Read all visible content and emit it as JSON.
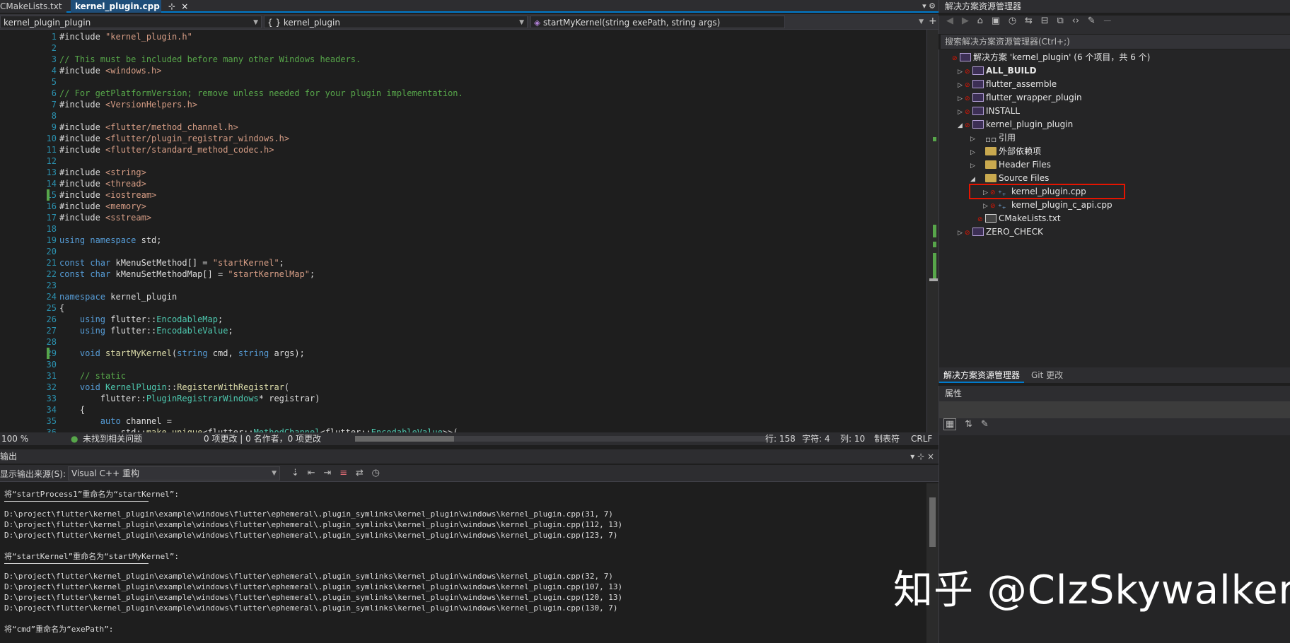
{
  "tabs": [
    {
      "label": "CMakeLists.txt",
      "active": false
    },
    {
      "label": "kernel_plugin.cpp",
      "active": true,
      "pin": "⊹",
      "close": "×"
    }
  ],
  "tabbar_icons": "▾ ⚙",
  "nav": {
    "project": "kernel_plugin_plugin",
    "scope": "{ } kernel_plugin",
    "member": "startMyKernel(string exePath, string args)"
  },
  "code_lines": [
    {
      "n": "1",
      "html": "<span class='plain'>#include </span><span class='inc'>\"kernel_plugin.h\"</span>"
    },
    {
      "n": "2",
      "html": ""
    },
    {
      "n": "3",
      "html": "<span class='cm'>// This must be included before many other Windows headers.</span>"
    },
    {
      "n": "4",
      "html": "<span class='plain'>#include </span><span class='inc'>&lt;windows.h&gt;</span>"
    },
    {
      "n": "5",
      "html": ""
    },
    {
      "n": "6",
      "html": "<span class='cm'>// For getPlatformVersion; remove unless needed for your plugin implementation.</span>"
    },
    {
      "n": "7",
      "html": "<span class='plain'>#include </span><span class='inc'>&lt;VersionHelpers.h&gt;</span>"
    },
    {
      "n": "8",
      "html": ""
    },
    {
      "n": "9",
      "html": "<span class='plain'>#include </span><span class='inc'>&lt;flutter/method_channel.h&gt;</span>"
    },
    {
      "n": "10",
      "html": "<span class='plain'>#include </span><span class='inc'>&lt;flutter/plugin_registrar_windows.h&gt;</span>"
    },
    {
      "n": "11",
      "html": "<span class='plain'>#include </span><span class='inc'>&lt;flutter/standard_method_codec.h&gt;</span>"
    },
    {
      "n": "12",
      "html": ""
    },
    {
      "n": "13",
      "html": "<span class='plain'>#include </span><span class='inc'>&lt;string&gt;</span>"
    },
    {
      "n": "14",
      "html": "<span class='plain'>#include </span><span class='inc'>&lt;thread&gt;</span>"
    },
    {
      "n": "15",
      "html": "<span class='plain'>#include </span><span class='inc'>&lt;iostream&gt;</span>",
      "changed": true
    },
    {
      "n": "16",
      "html": "<span class='plain'>#include </span><span class='inc'>&lt;memory&gt;</span>"
    },
    {
      "n": "17",
      "html": "<span class='plain'>#include </span><span class='inc'>&lt;sstream&gt;</span>"
    },
    {
      "n": "18",
      "html": ""
    },
    {
      "n": "19",
      "html": "<span class='kw'>using namespace</span><span class='plain'> std;</span>"
    },
    {
      "n": "20",
      "html": ""
    },
    {
      "n": "21",
      "html": "<span class='kw'>const char</span><span class='plain'> kMenuSetMethod[] = </span><span class='str'>\"startKernel\"</span><span class='plain'>;</span>"
    },
    {
      "n": "22",
      "html": "<span class='kw'>const char</span><span class='plain'> kMenuSetMethodMap[] = </span><span class='str'>\"startKernelMap\"</span><span class='plain'>;</span>"
    },
    {
      "n": "23",
      "html": ""
    },
    {
      "n": "24",
      "html": "<span class='kw'>namespace</span><span class='plain'> kernel_plugin</span>"
    },
    {
      "n": "25",
      "html": "<span class='plain'>{</span>"
    },
    {
      "n": "26",
      "html": "<span class='plain'>    </span><span class='kw'>using</span><span class='plain'> flutter::</span><span class='ty'>EncodableMap</span><span class='plain'>;</span>"
    },
    {
      "n": "27",
      "html": "<span class='plain'>    </span><span class='kw'>using</span><span class='plain'> flutter::</span><span class='ty'>EncodableValue</span><span class='plain'>;</span>"
    },
    {
      "n": "28",
      "html": ""
    },
    {
      "n": "29",
      "html": "<span class='plain'>    </span><span class='kw'>void</span><span class='plain'> </span><span class='fn'>startMyKernel</span><span class='plain'>(</span><span class='kw'>string</span><span class='plain'> cmd, </span><span class='kw'>string</span><span class='plain'> args);</span>",
      "changed": true
    },
    {
      "n": "30",
      "html": ""
    },
    {
      "n": "31",
      "html": "<span class='plain'>    </span><span class='cm'>// static</span>"
    },
    {
      "n": "32",
      "html": "<span class='plain'>    </span><span class='kw'>void</span><span class='plain'> </span><span class='ty'>KernelPlugin</span><span class='plain'>::</span><span class='fn'>RegisterWithRegistrar</span><span class='plain'>(</span>"
    },
    {
      "n": "33",
      "html": "<span class='plain'>        flutter::</span><span class='ty'>PluginRegistrarWindows</span><span class='plain'>* registrar)</span>"
    },
    {
      "n": "34",
      "html": "<span class='plain'>    {</span>"
    },
    {
      "n": "35",
      "html": "<span class='plain'>        </span><span class='kw'>auto</span><span class='plain'> channel =</span>"
    },
    {
      "n": "36",
      "html": "<span class='plain'>            std::</span><span class='fn'>make_unique</span><span class='plain'>&lt;flutter::</span><span class='ty'>MethodChannel</span><span class='plain'>&lt;flutter::</span><span class='ty'>EncodableValue</span><span class='plain'>&gt;&gt;(</span>"
    }
  ],
  "editor_status": {
    "zoom": "100 %",
    "issues": "未找到相关问题",
    "changes": "0 项更改 | 0 名作者，0 项更改",
    "line": "行: 158",
    "char": "字符: 4",
    "col": "列: 10",
    "tabs": "制表符",
    "eol": "CRLF"
  },
  "output": {
    "title": "输出",
    "source_label": "显示输出来源(S):",
    "source_value": "Visual C++ 重构",
    "lines": [
      {
        "t": "将“startProcess1”重命名为“startKernel”:",
        "kind": "head"
      },
      {
        "t": "",
        "kind": "sep"
      },
      {
        "t": "D:\\project\\flutter\\kernel_plugin\\example\\windows\\flutter\\ephemeral\\.plugin_symlinks\\kernel_plugin\\windows\\kernel_plugin.cpp(31, 7)",
        "kind": "path"
      },
      {
        "t": "D:\\project\\flutter\\kernel_plugin\\example\\windows\\flutter\\ephemeral\\.plugin_symlinks\\kernel_plugin\\windows\\kernel_plugin.cpp(112, 13)",
        "kind": "path"
      },
      {
        "t": "D:\\project\\flutter\\kernel_plugin\\example\\windows\\flutter\\ephemeral\\.plugin_symlinks\\kernel_plugin\\windows\\kernel_plugin.cpp(123, 7)",
        "kind": "path"
      },
      {
        "t": "",
        "kind": "blank"
      },
      {
        "t": "将“startKernel”重命名为“startMyKernel”:",
        "kind": "head"
      },
      {
        "t": "",
        "kind": "sep"
      },
      {
        "t": "D:\\project\\flutter\\kernel_plugin\\example\\windows\\flutter\\ephemeral\\.plugin_symlinks\\kernel_plugin\\windows\\kernel_plugin.cpp(32, 7)",
        "kind": "path"
      },
      {
        "t": "D:\\project\\flutter\\kernel_plugin\\example\\windows\\flutter\\ephemeral\\.plugin_symlinks\\kernel_plugin\\windows\\kernel_plugin.cpp(107, 13)",
        "kind": "path"
      },
      {
        "t": "D:\\project\\flutter\\kernel_plugin\\example\\windows\\flutter\\ephemeral\\.plugin_symlinks\\kernel_plugin\\windows\\kernel_plugin.cpp(120, 13)",
        "kind": "path"
      },
      {
        "t": "D:\\project\\flutter\\kernel_plugin\\example\\windows\\flutter\\ephemeral\\.plugin_symlinks\\kernel_plugin\\windows\\kernel_plugin.cpp(130, 7)",
        "kind": "path"
      },
      {
        "t": "",
        "kind": "blank"
      },
      {
        "t": "将“cmd”重命名为“exePath”:",
        "kind": "head"
      }
    ]
  },
  "solution_explorer": {
    "title": "解决方案资源管理器",
    "search_placeholder": "搜索解决方案资源管理器(Ctrl+;)",
    "nodes": [
      {
        "label": "解决方案 'kernel_plugin' (6 个项目，共 6 个)",
        "depth": 0,
        "icon": "proj",
        "twisty": "",
        "red": true,
        "bold": false
      },
      {
        "label": "ALL_BUILD",
        "depth": 1,
        "icon": "proj",
        "twisty": "▷",
        "red": true,
        "bold": true
      },
      {
        "label": "flutter_assemble",
        "depth": 1,
        "icon": "proj",
        "twisty": "▷",
        "red": true,
        "bold": false
      },
      {
        "label": "flutter_wrapper_plugin",
        "depth": 1,
        "icon": "proj",
        "twisty": "▷",
        "red": true,
        "bold": false
      },
      {
        "label": "INSTALL",
        "depth": 1,
        "icon": "proj",
        "twisty": "▷",
        "red": true,
        "bold": false
      },
      {
        "label": "kernel_plugin_plugin",
        "depth": 1,
        "icon": "proj",
        "twisty": "◢",
        "red": true,
        "bold": false
      },
      {
        "label": "引用",
        "depth": 2,
        "icon": "ref",
        "twisty": "▷",
        "red": false,
        "bold": false
      },
      {
        "label": "外部依赖项",
        "depth": 2,
        "icon": "ext",
        "twisty": "▷",
        "red": false,
        "bold": false
      },
      {
        "label": "Header Files",
        "depth": 2,
        "icon": "folder",
        "twisty": "▷",
        "red": false,
        "bold": false
      },
      {
        "label": "Source Files",
        "depth": 2,
        "icon": "folder",
        "twisty": "◢",
        "red": false,
        "bold": false
      },
      {
        "label": "kernel_plugin.cpp",
        "depth": 3,
        "icon": "cpp",
        "twisty": "▷",
        "red": true,
        "bold": false
      },
      {
        "label": "kernel_plugin_c_api.cpp",
        "depth": 3,
        "icon": "cpp",
        "twisty": "▷",
        "red": true,
        "bold": false
      },
      {
        "label": "CMakeLists.txt",
        "depth": 2,
        "icon": "file",
        "twisty": "",
        "red": true,
        "bold": false
      },
      {
        "label": "ZERO_CHECK",
        "depth": 1,
        "icon": "proj",
        "twisty": "▷",
        "red": true,
        "bold": false
      }
    ],
    "bottom_tabs": [
      "解决方案资源管理器",
      "Git 更改"
    ]
  },
  "properties": {
    "title": "属性"
  },
  "watermark": "知乎 @ClzSkywalker",
  "colors": {
    "accent": "#007acc",
    "highlight": "#e51400",
    "change": "#57a64a"
  }
}
